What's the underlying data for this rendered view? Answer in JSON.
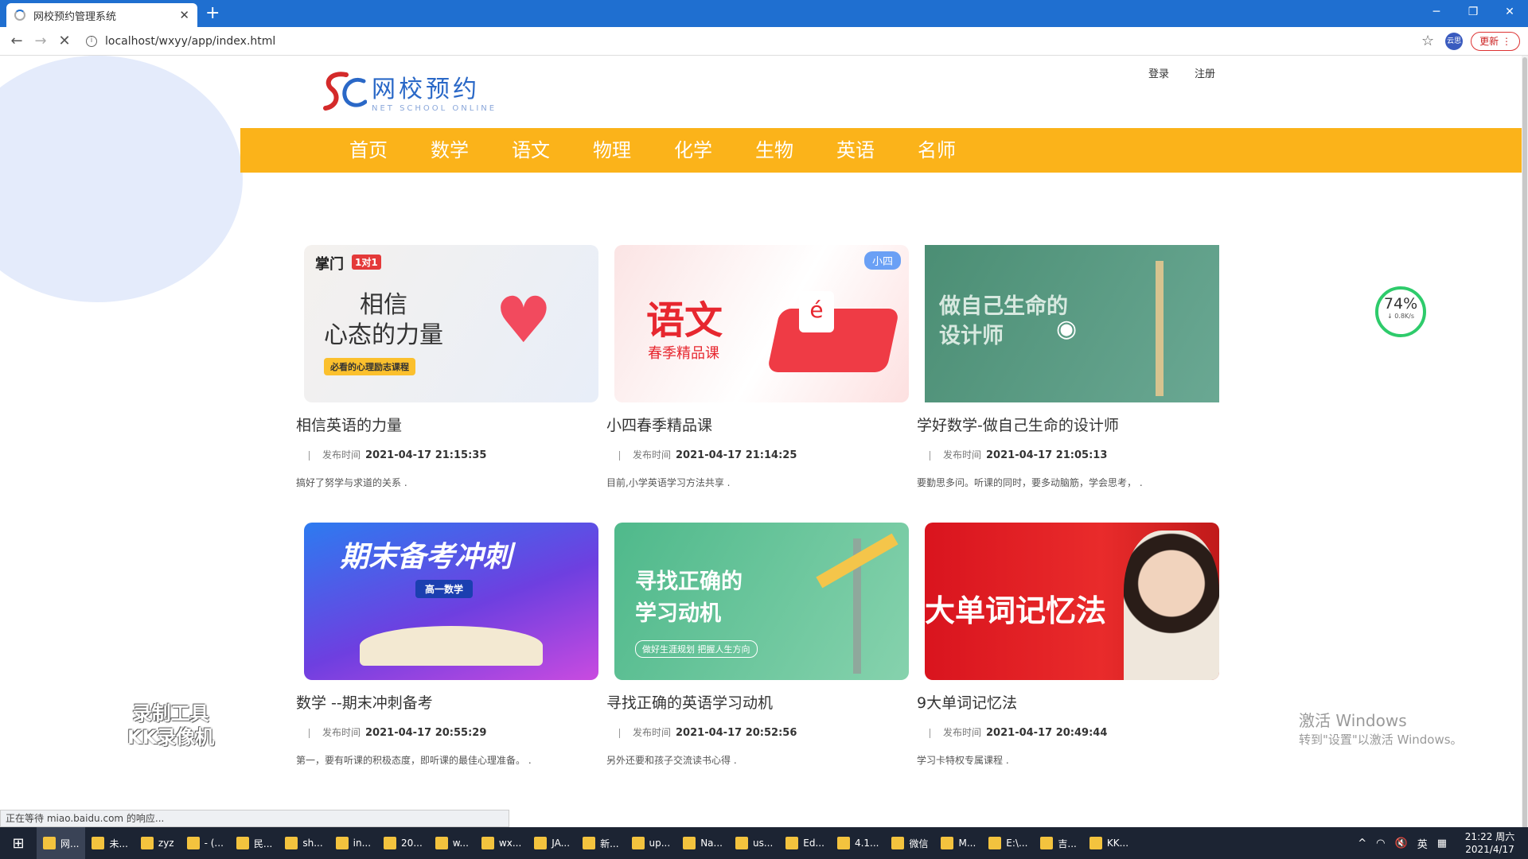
{
  "browser": {
    "tab_title": "网校预约管理系统",
    "url": "localhost/wxyy/app/index.html",
    "update_label": "更新",
    "ext_label": "云思"
  },
  "header": {
    "logo_cn": "网校预约",
    "logo_en": "NET SCHOOL ONLINE",
    "login": "登录",
    "register": "注册"
  },
  "nav": [
    "首页",
    "数学",
    "语文",
    "物理",
    "化学",
    "生物",
    "英语",
    "名师"
  ],
  "meta_label": "发布时间",
  "cards": [
    {
      "title": "相信英语的力量",
      "time": "2021-04-17 21:15:35",
      "desc": "搞好了努学与求道的关系 .",
      "art": {
        "brand": "掌门",
        "badge": "1对1",
        "line1": "相信",
        "line2": "心态的力量",
        "tag": "必看的心理励志课程"
      }
    },
    {
      "title": "小四春季精品课",
      "time": "2021-04-17 21:14:25",
      "desc": "目前,小学英语学习方法共享 .",
      "art": {
        "badge": "小四",
        "line1": "语文",
        "line2": "春季精品课"
      }
    },
    {
      "title": "学好数学-做自己生命的设计师",
      "time": "2021-04-17 21:05:13",
      "desc": "要勤思多问。听课的同时，要多动脑筋，学会思考， .",
      "art": {
        "line1": "做自己生命的",
        "line2": "设计师"
      }
    },
    {
      "title": "数学 --期末冲刺备考",
      "time": "2021-04-17 20:55:29",
      "desc": "第一，要有听课的积极态度，即听课的最佳心理准备。 .",
      "art": {
        "line1": "期末备考冲刺",
        "tag": "高一数学"
      }
    },
    {
      "title": "寻找正确的英语学习动机",
      "time": "2021-04-17 20:52:56",
      "desc": "另外还要和孩子交流读书心得 .",
      "art": {
        "line1": "寻找正确的",
        "line2": "学习动机",
        "tag": "做好生涯规划 把握人生方向"
      }
    },
    {
      "title": "9大单词记忆法",
      "time": "2021-04-17 20:49:44",
      "desc": "学习卡特权专属课程 .",
      "art": {
        "line1": "大单词记忆法"
      }
    }
  ],
  "speed": {
    "percent": "74",
    "rate": "0.8K/s"
  },
  "watermark": {
    "line1": "录制工具",
    "line2": "KK录像机"
  },
  "activate": {
    "line1": "激活 Windows",
    "line2": "转到\"设置\"以激活 Windows。"
  },
  "status": "正在等待 miao.baidu.com 的响应...",
  "taskbar": [
    "网...",
    "未...",
    "zyz",
    "- (...",
    "民...",
    "sh...",
    "in...",
    "20...",
    "w...",
    "wx...",
    "JA...",
    "新...",
    "up...",
    "Na...",
    "us...",
    "Ed...",
    "4.1...",
    "微信",
    "M...",
    "E:\\...",
    "吉...",
    "KK..."
  ],
  "tray": {
    "ime": "英"
  },
  "clock": {
    "time": "21:22 周六",
    "date": "2021/4/17"
  }
}
